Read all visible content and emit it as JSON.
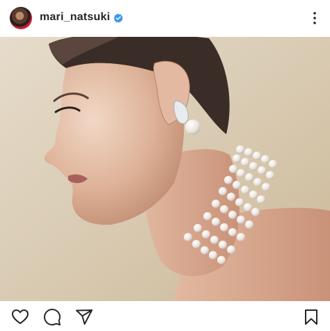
{
  "post": {
    "username": "mari_natsuki",
    "verified": true,
    "icons": {
      "verified": "verified-badge-icon",
      "more": "more-options-icon",
      "like": "heart-icon",
      "comment": "comment-icon",
      "share": "send-icon",
      "save": "bookmark-icon"
    }
  },
  "colors": {
    "verified_blue": "#3897f0",
    "text": "#262626",
    "avatar_accent": "#c51d34"
  }
}
